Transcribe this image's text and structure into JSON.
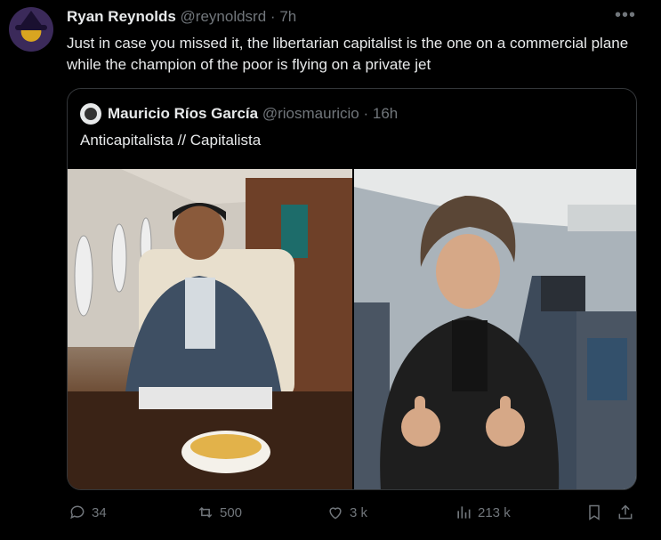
{
  "author": {
    "name": "Ryan Reynolds",
    "handle": "@reynoldsrd",
    "time": "7h"
  },
  "tweet_text": "Just in case you missed it, the libertarian capitalist is the one on a commercial plane while the champion of the poor is flying on a private jet",
  "quoted": {
    "name": "Mauricio Ríos García",
    "handle": "@riosmauricio",
    "time": "16h",
    "text": "Anticapitalista // Capitalista"
  },
  "stats": {
    "replies": "34",
    "reposts": "500",
    "likes": "3 k",
    "views": "213 k"
  },
  "icons": {
    "more": "more-icon",
    "reply": "reply-icon",
    "repost": "repost-icon",
    "like": "heart-icon",
    "views": "views-icon",
    "bookmark": "bookmark-icon",
    "share": "share-icon"
  },
  "colors": {
    "background": "#000000",
    "text": "#e7e9ea",
    "muted": "#71767b",
    "border": "#333639"
  }
}
